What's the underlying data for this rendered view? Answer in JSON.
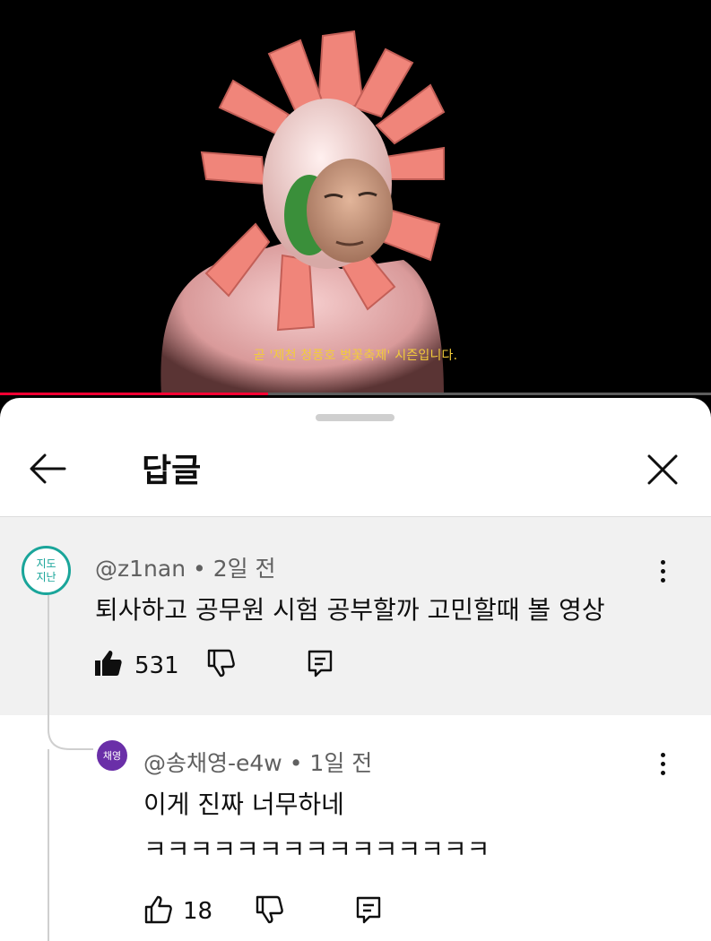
{
  "video": {
    "subtitle": "곧 '제천 청풍호 벚꽃축제' 시즌입니다.",
    "progress_fraction": 0.377,
    "progress_color": "#ff0033"
  },
  "sheet": {
    "title": "답글",
    "back_icon": "arrow-left-icon",
    "close_icon": "close-icon"
  },
  "comment": {
    "avatar_text_line1": "지도",
    "avatar_text_line2": "지난",
    "avatar_color": "#1aa59a",
    "author": "@z1nan",
    "time": "2일 전",
    "text": "퇴사하고 공무원 시험 공부할까 고민할때 볼 영상",
    "likes": "531",
    "like_icon": "thumbs-up-filled-icon",
    "dislike_icon": "thumbs-down-icon",
    "reply_icon": "reply-icon",
    "menu_icon": "more-vertical-icon"
  },
  "reply": {
    "avatar_text": "채영",
    "avatar_color": "#6a2fa8",
    "author": "@송채영-e4w",
    "time": "1일 전",
    "text_line1": "이게 진짜 너무하네",
    "text_line2": "ㅋㅋㅋㅋㅋㅋㅋㅋㅋㅋㅋㅋㅋㅋㅋ",
    "likes": "18",
    "like_icon": "thumbs-up-icon",
    "dislike_icon": "thumbs-down-icon",
    "reply_icon": "reply-icon",
    "menu_icon": "more-vertical-icon"
  }
}
